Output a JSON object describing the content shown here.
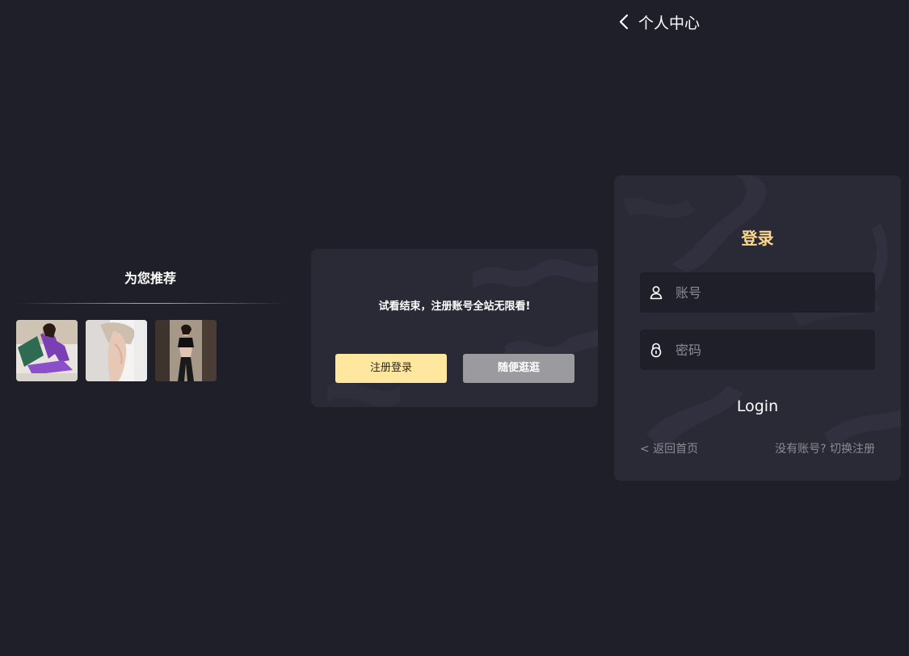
{
  "header": {
    "back_icon": "chevron-left-icon",
    "title": "个人中心"
  },
  "recommend": {
    "title": "为您推荐",
    "thumbnails": [
      {
        "icon": "thumbnail-image"
      },
      {
        "icon": "thumbnail-image"
      },
      {
        "icon": "thumbnail-image"
      }
    ]
  },
  "trial": {
    "message": "试看结束，注册账号全站无限看!",
    "register_label": "注册登录",
    "browse_label": "随便逛逛"
  },
  "login": {
    "title": "登录",
    "account_placeholder": "账号",
    "account_icon": "user-icon",
    "password_placeholder": "密码",
    "password_icon": "lock-icon",
    "submit_label": "Login",
    "back_home_label": "< 返回首页",
    "switch_register_label": "没有账号? 切换注册"
  },
  "colors": {
    "background": "#1f1f29",
    "card": "#2a2a37",
    "accent_gold": "#ffd98a",
    "primary_button": "#ffe7a0",
    "secondary_button": "#9b9b9f",
    "muted_text": "#8b8b93"
  }
}
